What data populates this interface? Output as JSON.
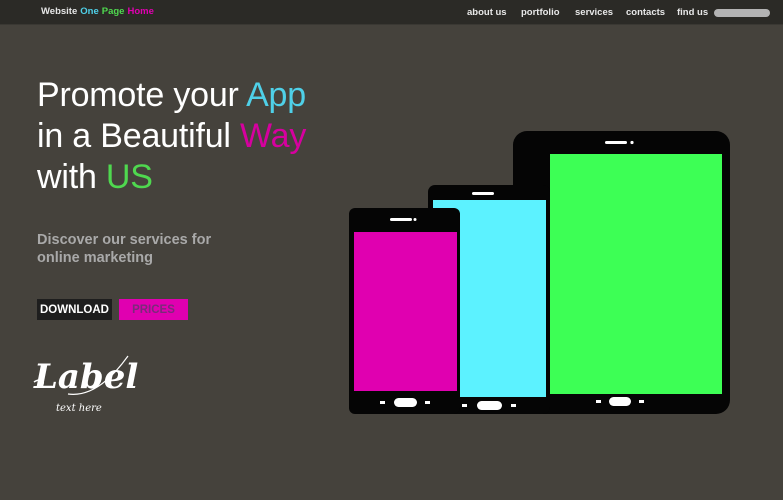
{
  "nav": {
    "brand": [
      "Website",
      "One",
      "Page",
      "Home"
    ],
    "brand_colors": [
      "#e6e6e6",
      "#4fd0e8",
      "#4fd84f",
      "#e000b0"
    ],
    "items": [
      "about us",
      "portfolio",
      "services",
      "contacts",
      "find us"
    ]
  },
  "hero": {
    "line1_prefix": "Promote your ",
    "line1_highlight": "App",
    "line2_prefix": "in a Beautiful ",
    "line2_highlight": "Way",
    "line3_prefix": "with ",
    "line3_highlight": "US",
    "highlight_colors": [
      "#4fd0e8",
      "#d6009f",
      "#4fd84f"
    ],
    "subtitle": "Discover our services for online marketing"
  },
  "buttons": {
    "download": "DOWNLOAD",
    "prices": "PRICES"
  },
  "logo": {
    "title": "Label",
    "tagline": "text here"
  },
  "devices": {
    "screen_colors": [
      "#e000b0",
      "#5cf2ff",
      "#3dff55"
    ],
    "frame_color": "#050505"
  }
}
